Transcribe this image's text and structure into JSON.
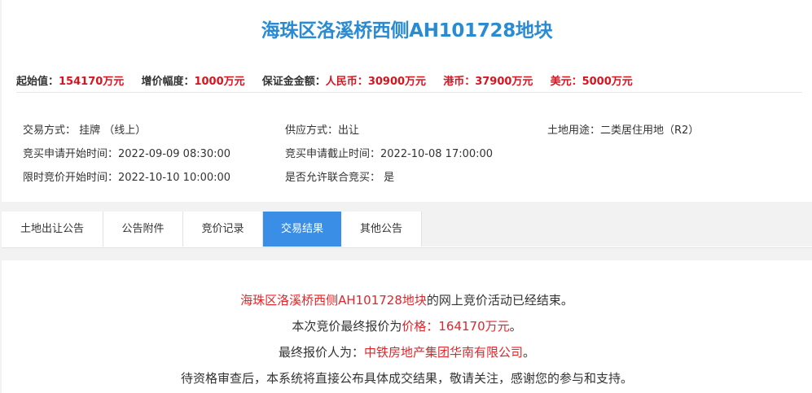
{
  "title": "海珠区洛溪桥西侧AH101728地块",
  "price_bar": {
    "start_price_label": "起始值：",
    "start_price_value": "154170万元",
    "increment_label": "增价幅度：",
    "increment_value": "1000万元",
    "deposit_label": "保证金金额：",
    "rmb_label": "人民币：",
    "rmb_value": "30900万元",
    "hkd_label": "港币：",
    "hkd_value": "37900万元",
    "usd_label": "美元：",
    "usd_value": "5000万元"
  },
  "info": {
    "trade_method": "交易方式： 挂牌 （线上）",
    "supply_method": "供应方式：出让",
    "land_use": "土地用途：二类居住用地（R2）",
    "apply_start": "竞买申请开始时间：2022-09-09 08:30:00",
    "apply_end": "竞买申请截止时间：2022-10-08 17:00:00",
    "bid_start": "限时竞价开始时间：2022-10-10 10:00:00",
    "joint_bid": "是否允许联合竞买： 是"
  },
  "tabs": [
    {
      "label": "土地出让公告",
      "active": false
    },
    {
      "label": "公告附件",
      "active": false
    },
    {
      "label": "竞价记录",
      "active": false
    },
    {
      "label": "交易结果",
      "active": true
    },
    {
      "label": "其他公告",
      "active": false
    }
  ],
  "result": {
    "line1_parcel": "海珠区洛溪桥西侧AH101728地块",
    "line1_rest": "的网上竞价活动已经结束。",
    "line2_prefix": "本次竞价最终报价为",
    "line2_price": "价格：164170万元",
    "line2_suffix": "。",
    "line3_prefix": "最终报价人为：",
    "line3_bidder": "中铁房地产集团华南有限公司",
    "line3_suffix": "。",
    "line4": "待资格审查后，本系统将直接公布具体成交结果，敬请关注，感谢您的参与和支持。"
  },
  "colors": {
    "title_blue": "#2a8bd3",
    "accent_red": "#e0262b",
    "tab_active": "#3a8ee6"
  }
}
